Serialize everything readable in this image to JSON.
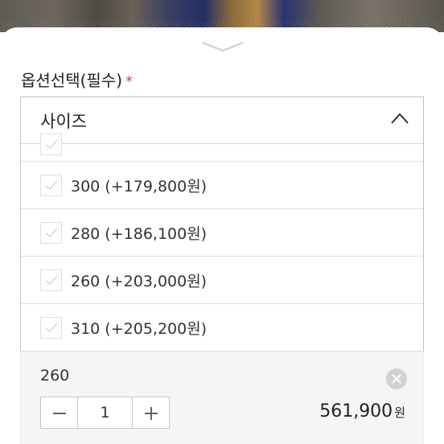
{
  "header": {
    "title": "옵션선택(필수)",
    "required_mark": "*"
  },
  "dropdown": {
    "title": "사이즈",
    "options": [
      {
        "label": ""
      },
      {
        "label": "300 (+179,800원)"
      },
      {
        "label": "280 (+186,100원)"
      },
      {
        "label": "260 (+203,000원)"
      },
      {
        "label": "310 (+205,200원)"
      }
    ]
  },
  "selected": {
    "size": "260",
    "quantity": "1",
    "price": "561,900",
    "price_unit": "원"
  },
  "icons": {
    "handle": "chevron-down-icon",
    "dropdown_toggle": "chevron-up-icon",
    "checkbox": "check-icon",
    "remove": "close-icon",
    "minus": "minus-icon",
    "plus": "plus-icon"
  },
  "colors": {
    "required": "#e2363c",
    "border": "#bfbfbf",
    "panel_bg": "#f5f5f5"
  }
}
